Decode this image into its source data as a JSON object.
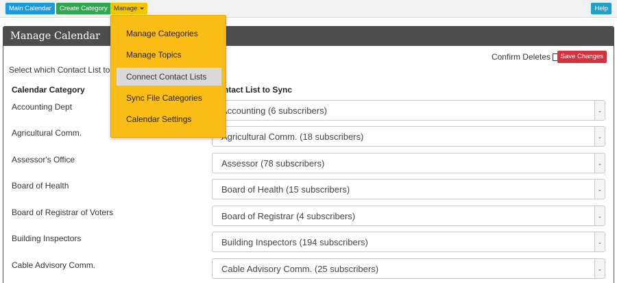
{
  "topbar": {
    "main_calendar": "Main Calendar",
    "create_category": "Create Category",
    "manage": "Manage",
    "help": "Help"
  },
  "panel": {
    "title": "Manage Calendar",
    "confirm_deletes": "Confirm Deletes",
    "save_changes": "Save Changes",
    "instructions": "Select which Contact List to",
    "col_category": "Calendar Category",
    "col_contact": "ntact List to Sync"
  },
  "rows": [
    {
      "category": "Accounting Dept",
      "contact": "Accounting (6 subscribers)"
    },
    {
      "category": "Agricultural Comm.",
      "contact": "Agricultural Comm. (18 subscribers)"
    },
    {
      "category": "Assessor's Office",
      "contact": "Assessor (78 subscribers)"
    },
    {
      "category": "Board of Health",
      "contact": "Board of Health (15 subscribers)"
    },
    {
      "category": "Board of Registrar of Voters",
      "contact": "Board of Registrar (4 subscribers)"
    },
    {
      "category": "Building Inspectors",
      "contact": "Building Inspectors (194 subscribers)"
    },
    {
      "category": "Cable Advisory Comm.",
      "contact": "Cable Advisory Comm. (25 subscribers)"
    }
  ],
  "manage_menu": [
    {
      "label": "Manage Categories"
    },
    {
      "label": "Manage Topics"
    },
    {
      "label": "Connect Contact Lists"
    },
    {
      "label": "Sync File Categories"
    },
    {
      "label": "Calendar Settings"
    }
  ],
  "colors": {
    "main_calendar_btn": "#1a9ae0",
    "create_category_btn": "#2ea84f",
    "manage_btn": "#f5c400",
    "help_btn": "#1da0c9",
    "save_btn": "#d9303e",
    "dropdown_bg": "#f9bd16",
    "panel_header": "#4d4d4d"
  }
}
